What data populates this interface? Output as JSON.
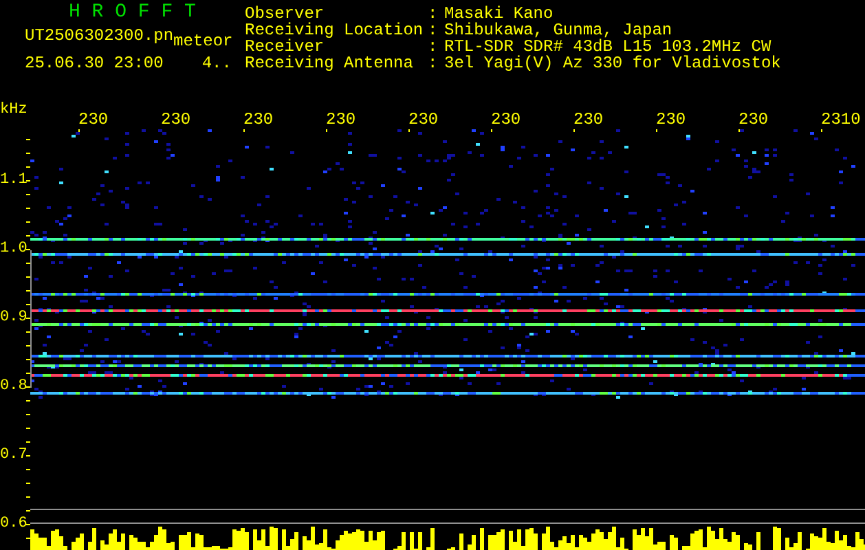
{
  "title": "H R O F F T",
  "file": {
    "name": "UT2506302300.pn",
    "suffix": "meteor"
  },
  "timestamp": "25.06.30 23:00",
  "count": "4..",
  "info": [
    {
      "label": "Observer",
      "separator": ":",
      "value": "Masaki Kano"
    },
    {
      "label": "Receiving Location",
      "separator": ":",
      "value": "Shibukawa, Gunma, Japan"
    },
    {
      "label": "Receiver",
      "separator": ":",
      "value": "RTL-SDR SDR# 43dB L15 103.2MHz CW"
    },
    {
      "label": "Receiving Antenna",
      "separator": ":",
      "value": "3el Yagi(V) Az 330 for Vladivostok"
    }
  ],
  "y_axis": {
    "unit": "kHz",
    "labels": [
      "1.1",
      "1.0",
      "0.9",
      "0.8",
      "0.7",
      "0.6"
    ]
  },
  "x_axis": {
    "labels": [
      "230",
      "230",
      "230",
      "230",
      "230",
      "230",
      "230",
      "230",
      "230",
      "2310"
    ]
  }
}
